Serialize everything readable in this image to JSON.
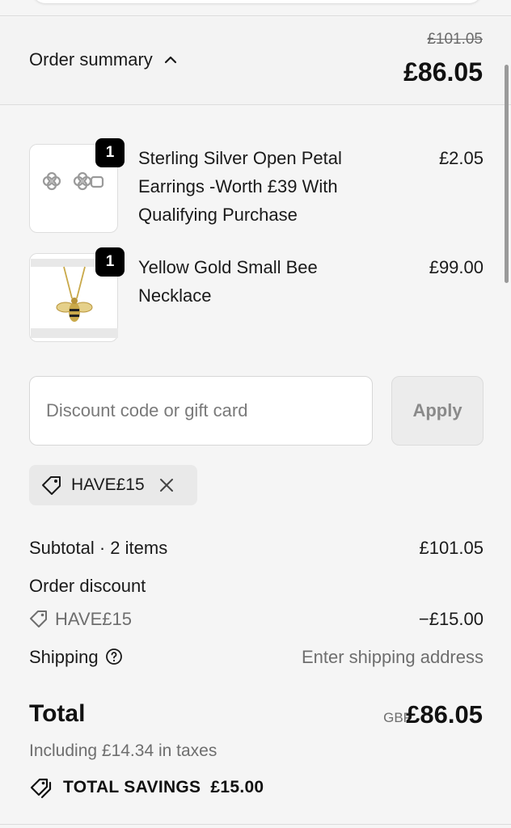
{
  "summary": {
    "toggle_label": "Order summary",
    "original_total": "£101.05",
    "total": "£86.05"
  },
  "items": [
    {
      "quantity": "1",
      "title": "Sterling Silver Open Petal Earrings -Worth £39 With Qualifying Purchase",
      "price": "£2.05",
      "image_icon": "earrings-icon"
    },
    {
      "quantity": "1",
      "title": "Yellow Gold Small Bee Necklace",
      "price": "£99.00",
      "image_icon": "bee-necklace-icon"
    }
  ],
  "discount": {
    "placeholder": "Discount code or gift card",
    "apply_label": "Apply",
    "applied_code": "HAVE£15"
  },
  "totals": {
    "subtotal_label": "Subtotal · 2 items",
    "subtotal_value": "£101.05",
    "order_discount_label": "Order discount",
    "discount_code": "HAVE£15",
    "discount_value": "−£15.00",
    "shipping_label": "Shipping",
    "shipping_value": "Enter shipping address",
    "total_label": "Total",
    "currency": "GBP",
    "total_value": "£86.05",
    "taxes_note": "Including £14.34 in taxes",
    "savings_label": "TOTAL SAVINGS",
    "savings_value": "£15.00"
  },
  "colors": {
    "background": "#f5f5f5",
    "badge": "#000000",
    "muted": "#6e6e6e"
  }
}
